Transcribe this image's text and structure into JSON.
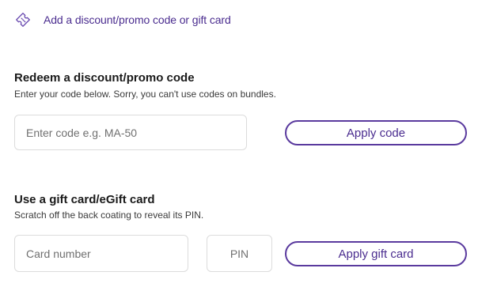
{
  "promo_toggle": {
    "label": "Add a discount/promo code or gift card",
    "icon": "ticket-icon"
  },
  "promo": {
    "title": "Redeem a discount/promo code",
    "description": "Enter your code below. Sorry, you can't use codes on bundles.",
    "code_input": {
      "placeholder": "Enter code e.g. MA-50",
      "value": ""
    },
    "apply_label": "Apply code"
  },
  "gift": {
    "title": "Use a gift card/eGift card",
    "description": "Scratch off the back coating to reveal its PIN.",
    "card_input": {
      "placeholder": "Card number",
      "value": ""
    },
    "pin_input": {
      "placeholder": "PIN",
      "value": ""
    },
    "apply_label": "Apply gift card"
  },
  "colors": {
    "accent": "#5a3a9e",
    "accent_text": "#4a2c8f",
    "input_border": "#dcdcdc"
  }
}
